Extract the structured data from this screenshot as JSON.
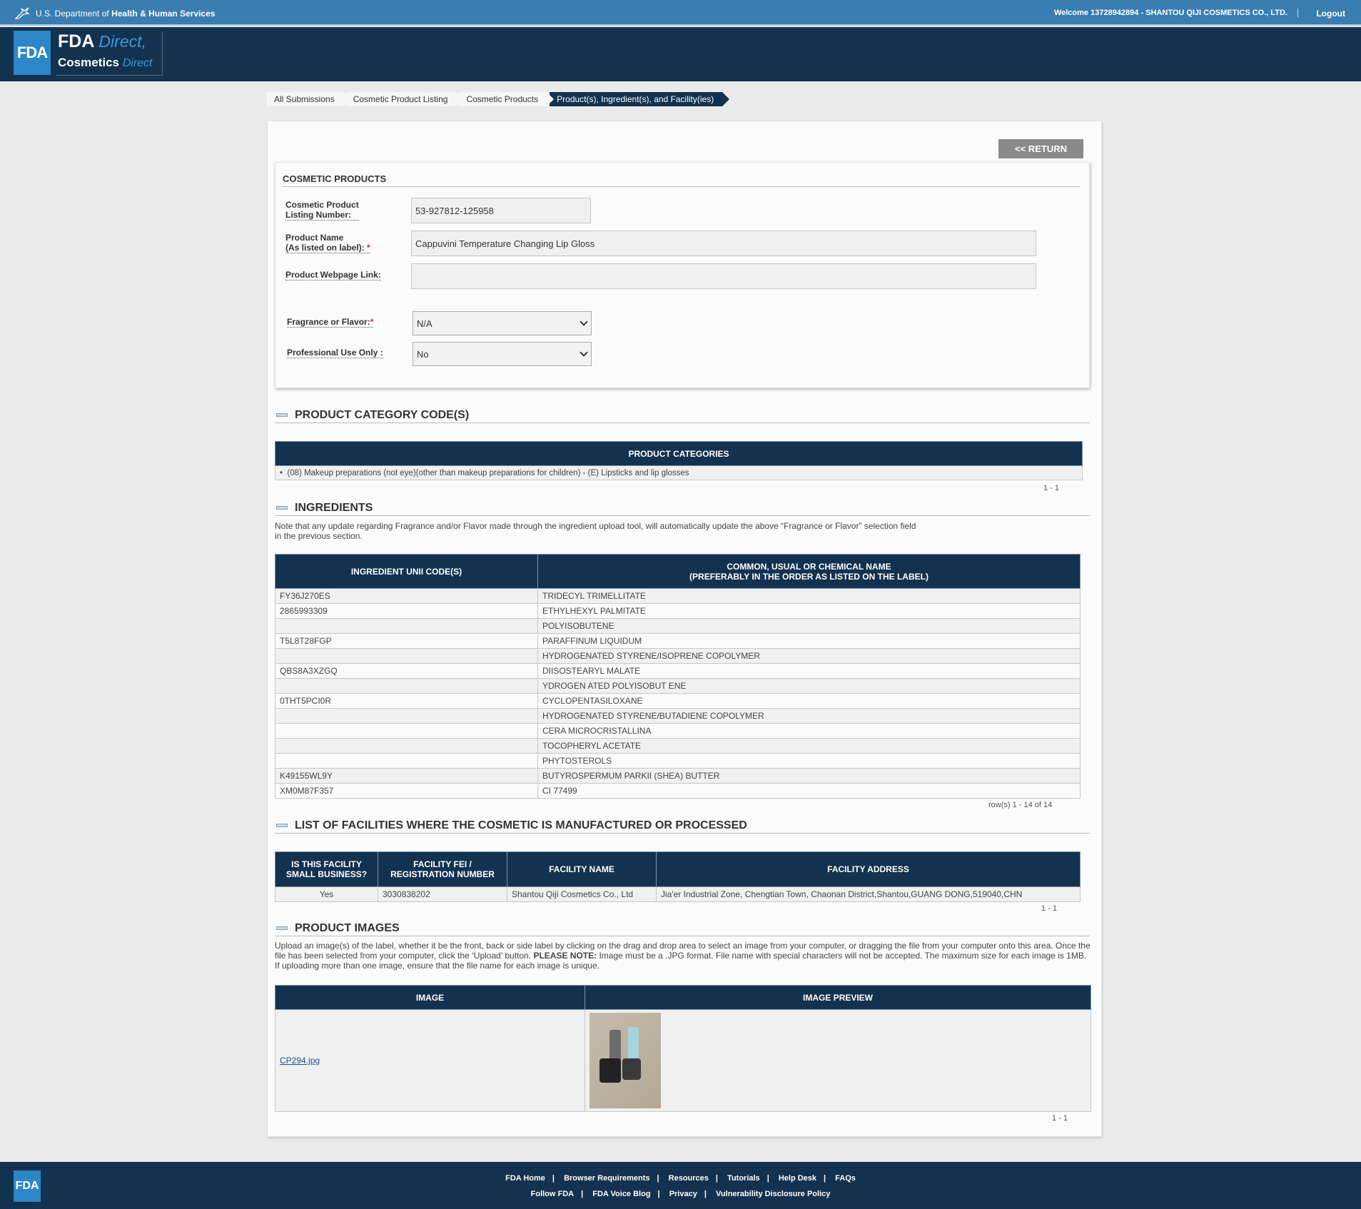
{
  "topbar": {
    "agency_prefix": "U.S. Department of",
    "agency_name": "Health & Human Services",
    "welcome": "Welcome 13728942894 - SHANTOU QIJI COSMETICS CO., LTD.",
    "logout": "Logout"
  },
  "header": {
    "logo": "FDA",
    "brand_fda": "FDA",
    "brand_direct": "Direct,",
    "brand_cosmetics": "Cosmetics",
    "brand_direct2": "Direct"
  },
  "breadcrumb": [
    "All Submissions",
    "Cosmetic Product Listing",
    "Cosmetic Products",
    "Product(s), Ingredient(s), and Facility(ies)"
  ],
  "return_label": "<< RETURN",
  "cosmetic_products": {
    "title": "COSMETIC PRODUCTS",
    "listing_number_label_1": "Cosmetic Product",
    "listing_number_label_2": "Listing Number:",
    "listing_number": "53-927812-125958",
    "product_name_label_1": "Product Name",
    "product_name_label_2": "(As listed on label):",
    "product_name": "Cappuvini Temperature Changing Lip Gloss",
    "webpage_label": "Product Webpage Link:",
    "webpage_value": "",
    "fragrance_label": "Fragrance or Flavor:",
    "fragrance_value": "N/A",
    "professional_label": "Professional Use Only :",
    "professional_value": "No",
    "required_mark": "*"
  },
  "categories": {
    "title": "PRODUCT CATEGORY CODE(S)",
    "header": "PRODUCT CATEGORIES",
    "item": "(08) Makeup preparations (not eye)(other than makeup preparations for children) - (E) Lipsticks and lip glosses",
    "pager": "1 - 1"
  },
  "ingredients": {
    "title": "INGREDIENTS",
    "note_1": "Note that any update regarding Fragrance and/or Flavor made through the ingredient upload tool, will automatically update the above “Fragrance or Flavor” selection field",
    "note_2": "in the previous section.",
    "col1": "INGREDIENT UNII CODE(S)",
    "col2_1": "COMMON, USUAL OR CHEMICAL NAME",
    "col2_2": "(PREFERABLY IN THE ORDER AS LISTED ON THE LABEL)",
    "rows": [
      {
        "code": "FY36J270ES",
        "name": "TRIDECYL TRIMELLITATE"
      },
      {
        "code": "2865993309",
        "name": "ETHYLHEXYL PALMITATE"
      },
      {
        "code": "",
        "name": "POLYISOBUTENE"
      },
      {
        "code": "T5L8T28FGP",
        "name": "PARAFFINUM LIQUIDUM"
      },
      {
        "code": "",
        "name": "HYDROGENATED STYRENE/ISOPRENE COPOLYMER"
      },
      {
        "code": "QBS8A3XZGQ",
        "name": "DIISOSTEARYL MALATE"
      },
      {
        "code": "",
        "name": "YDROGEN ATED POLYISOBUT ENE"
      },
      {
        "code": "0THT5PCI0R",
        "name": "CYCLOPENTASILOXANE"
      },
      {
        "code": "",
        "name": "HYDROGENATED STYRENE/BUTADIENE COPOLYMER"
      },
      {
        "code": "",
        "name": "CERA MICROCRISTALLINA"
      },
      {
        "code": "",
        "name": "TOCOPHERYL ACETATE"
      },
      {
        "code": "",
        "name": "PHYTOSTEROLS"
      },
      {
        "code": "K49155WL9Y",
        "name": "BUTYROSPERMUM PARKII (SHEA) BUTTER"
      },
      {
        "code": "XM0M87F357",
        "name": "CI 77499"
      }
    ],
    "pager": "row(s) 1 - 14 of 14"
  },
  "facilities": {
    "title": "LIST OF FACILITIES WHERE THE COSMETIC IS MANUFACTURED OR PROCESSED",
    "col1_1": "IS THIS FACILITY",
    "col1_2": "SMALL BUSINESS?",
    "col2_1": "FACILITY FEI /",
    "col2_2": "REGISTRATION NUMBER",
    "col3": "FACILITY NAME",
    "col4": "FACILITY ADDRESS",
    "row": {
      "small_business": "Yes",
      "fei": "3030838202",
      "name": "Shantou Qiji Cosmetics Co., Ltd",
      "address": "Jia'er Industrial Zone, Chengtian Town, Chaonan District,Shantou,GUANG DONG,519040,CHN"
    },
    "pager": "1 - 1"
  },
  "images": {
    "title": "PRODUCT IMAGES",
    "note_1": "Upload an image(s) of the label, whether it be the front, back or side label by clicking on the drag and drop area to select an image from your computer, or dragging the file from your computer onto this area. Once the",
    "note_2a": "file has been selected from your computer, click the ‘Upload’ button.",
    "note_2b": "PLEASE NOTE:",
    "note_2c": "Image must be a .JPG format. File name with special characters will not be accepted. The maximum size for each image is 1MB.",
    "note_3": "If uploading more than one image, ensure that the file name for each image is unique.",
    "col1": "IMAGE",
    "col2": "IMAGE PREVIEW",
    "file": "CP294.jpg",
    "pager": "1 - 1"
  },
  "footer": {
    "logo": "FDA",
    "row1": [
      "FDA Home",
      "Browser Requirements",
      "Resources",
      "Tutorials",
      "Help Desk",
      "FAQs"
    ],
    "row2": [
      "Follow FDA",
      "FDA Voice Blog",
      "Privacy",
      "Vulnerability Disclosure Policy"
    ],
    "sep": "|"
  }
}
